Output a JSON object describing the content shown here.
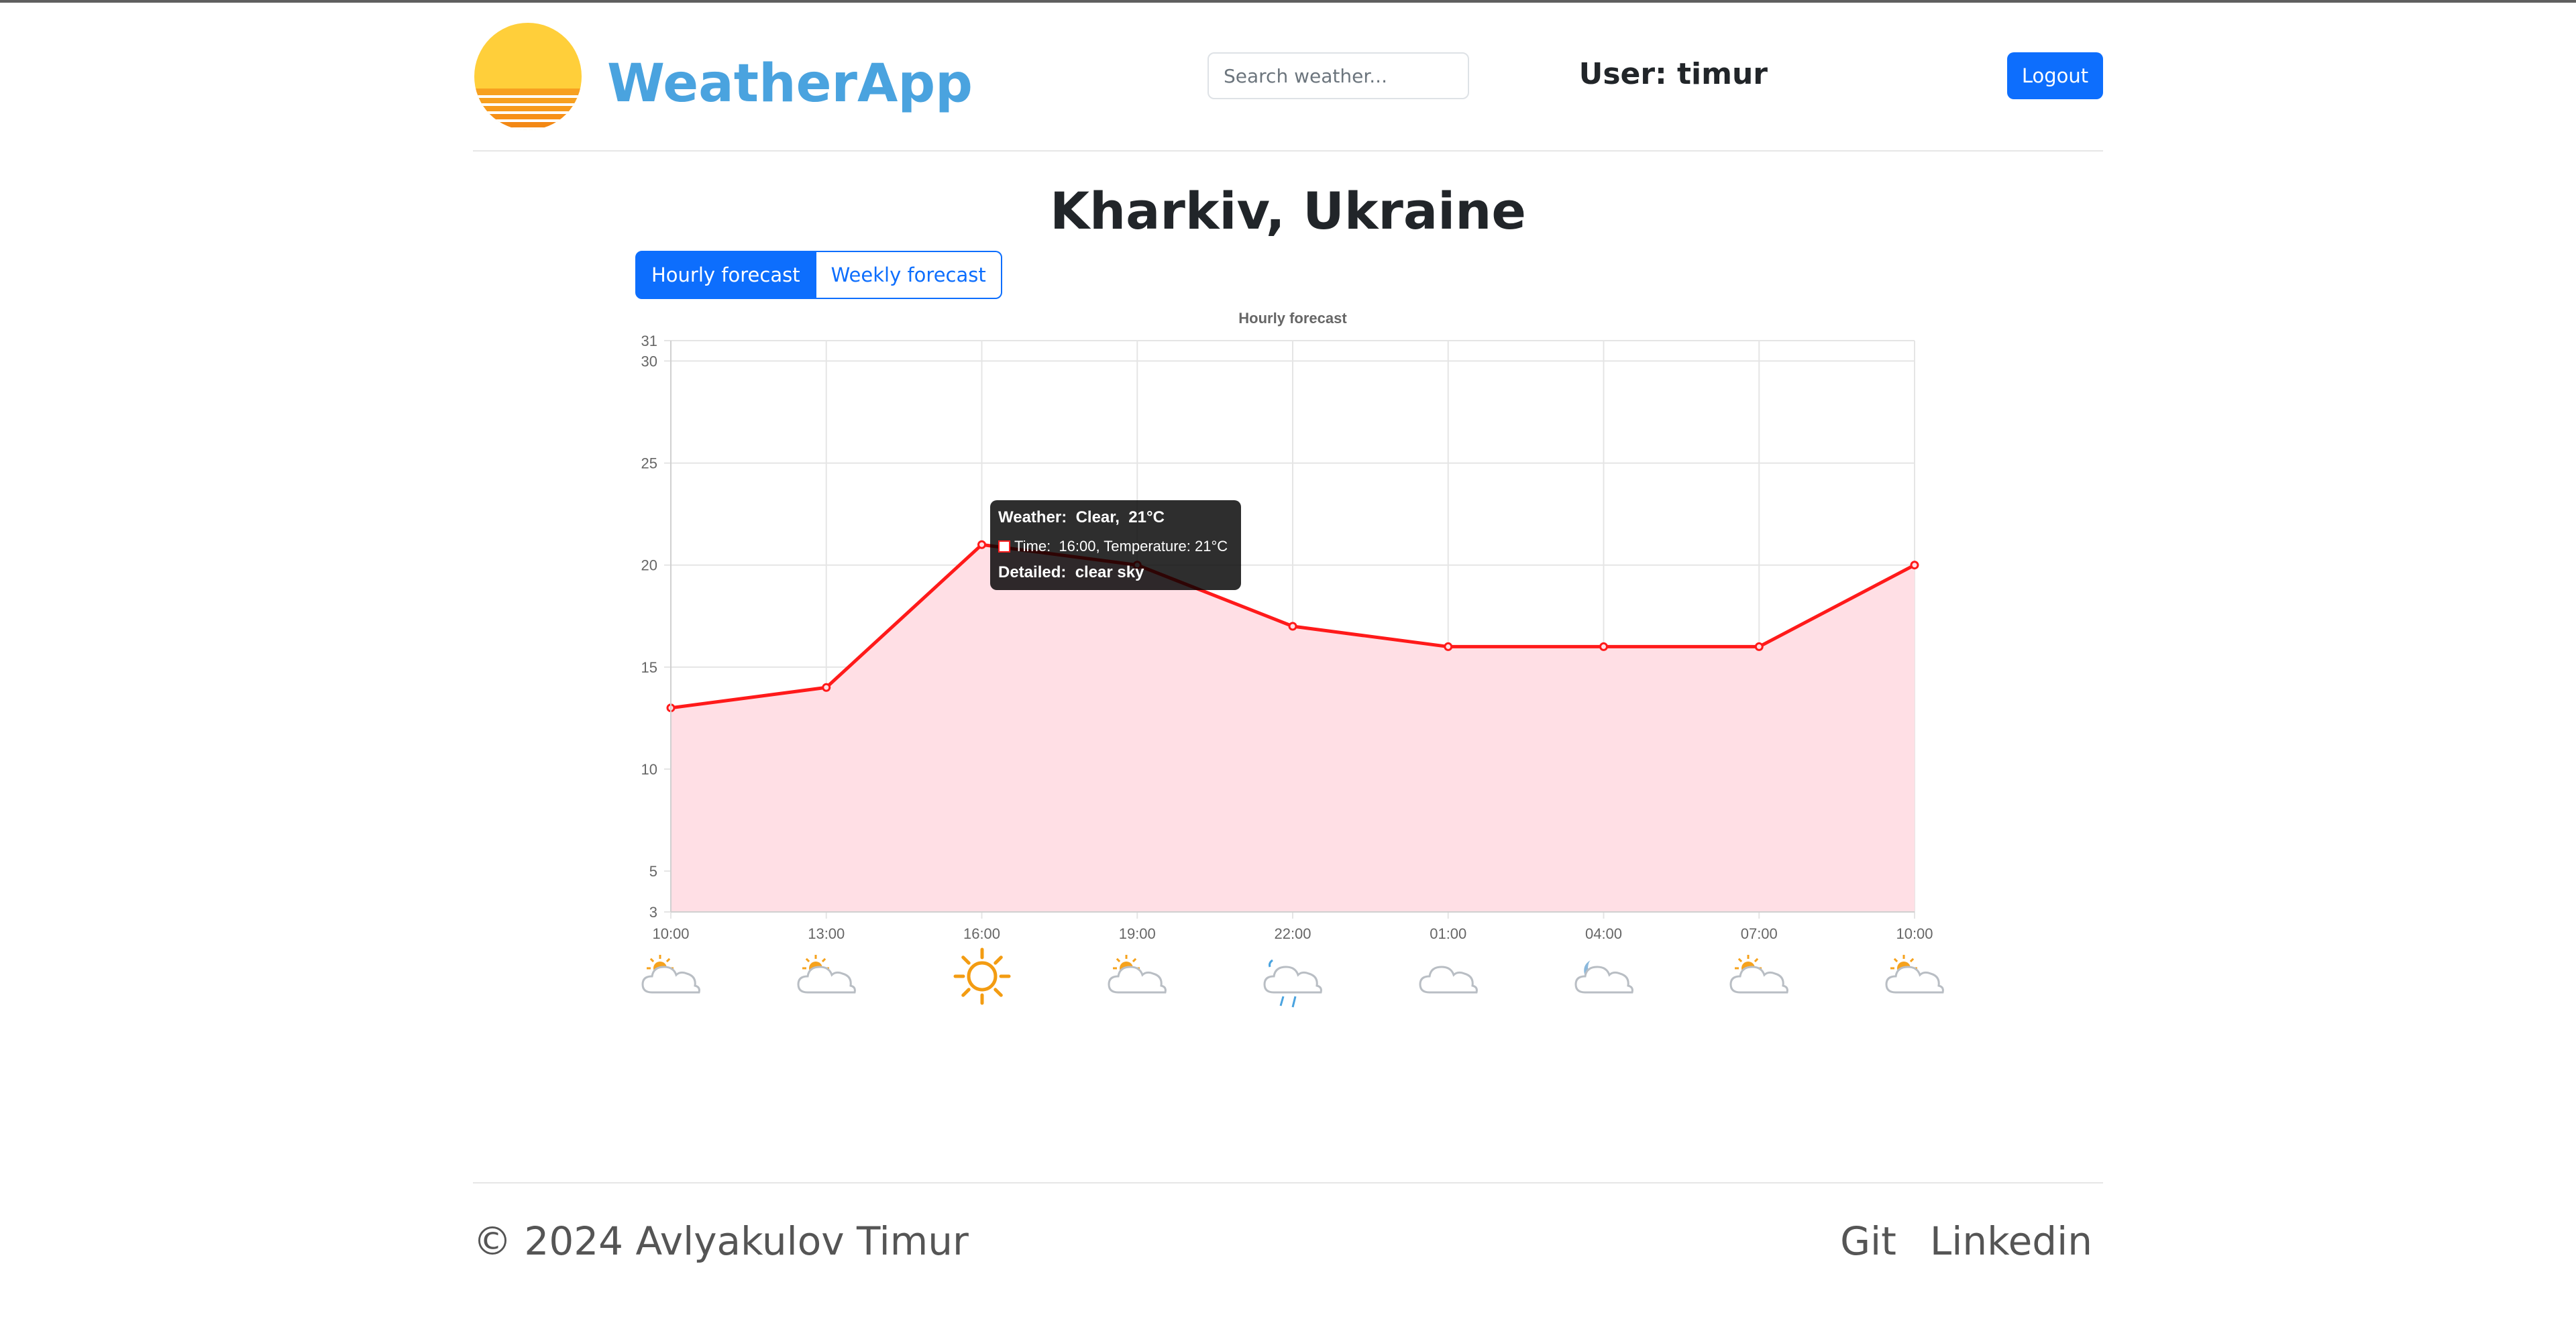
{
  "header": {
    "brand": "WeatherApp",
    "search_placeholder": "Search weather...",
    "user_label": "User: timur",
    "logout_label": "Logout"
  },
  "main": {
    "city": "Kharkiv, Ukraine",
    "tabs": [
      {
        "label": "Hourly forecast",
        "active": true
      },
      {
        "label": "Weekly forecast",
        "active": false
      }
    ]
  },
  "chart_data": {
    "type": "area",
    "title": "Hourly forecast",
    "x": [
      "10:00",
      "13:00",
      "16:00",
      "19:00",
      "22:00",
      "01:00",
      "04:00",
      "07:00",
      "10:00"
    ],
    "series": [
      {
        "values": [
          13,
          14,
          21,
          20,
          17,
          16,
          16,
          16,
          20
        ],
        "color": "#ff1a1a",
        "fill": "#ffdfe5"
      }
    ],
    "ylim": [
      3,
      31
    ],
    "yticks": [
      3,
      5,
      10,
      15,
      20,
      25,
      30,
      31
    ],
    "grid": true,
    "tooltip": {
      "title": "Weather:  Clear,  21°C",
      "body": "Time:  16:00, Temperature: 21°C",
      "footer": "Detailed:  clear sky"
    },
    "weather_icons": [
      "partly-cloudy-icon",
      "partly-cloudy-icon",
      "sun-icon",
      "partly-cloudy-icon",
      "rain-cloud-icon",
      "cloud-icon",
      "moon-cloud-icon",
      "partly-cloudy-icon",
      "partly-cloudy-icon"
    ]
  },
  "footer": {
    "copyright": "© 2024 Avlyakulov Timur",
    "links": [
      "Git",
      "Linkedin"
    ]
  }
}
